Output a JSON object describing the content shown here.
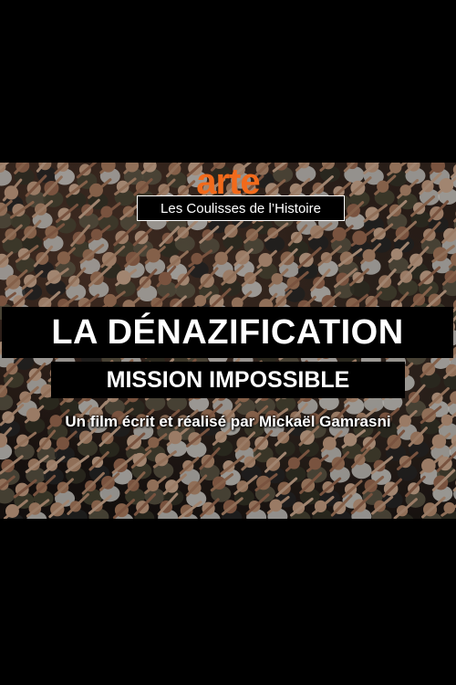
{
  "poster": {
    "logo_text": "arte",
    "series": "Les Coulisses de l’Histoire",
    "title": "LA DÉNAZIFICATION",
    "subtitle": "MISSION IMPOSSIBLE",
    "credit": "Un film écrit et réalisé par Mickaël Gamrasni",
    "colors": {
      "logo": "#f26a1b",
      "background": "#000000",
      "text": "#ffffff"
    }
  }
}
